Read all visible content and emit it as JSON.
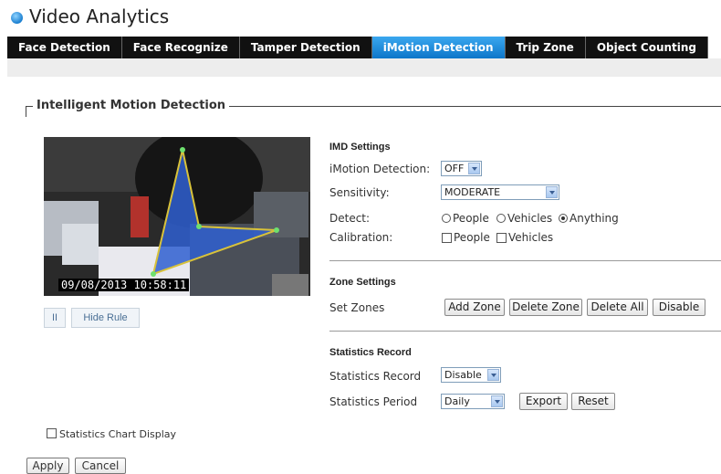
{
  "app": {
    "title": "Video Analytics",
    "logo_icon": "blue-orb-icon"
  },
  "tabs": [
    {
      "label": "Face Detection",
      "active": false
    },
    {
      "label": "Face Recognize",
      "active": false
    },
    {
      "label": "Tamper Detection",
      "active": false
    },
    {
      "label": "iMotion Detection",
      "active": true
    },
    {
      "label": "Trip Zone",
      "active": false
    },
    {
      "label": "Object Counting",
      "active": false
    }
  ],
  "section_title": "Intelligent Motion Detection",
  "video": {
    "timestamp": "09/08/2013   10:58:11",
    "pause_label": "II",
    "hide_rule_label": "Hide Rule"
  },
  "imd": {
    "heading": "IMD Settings",
    "imotion_label": "iMotion Detection:",
    "imotion_value": "OFF",
    "sensitivity_label": "Sensitivity:",
    "sensitivity_value": "MODERATE",
    "detect_label": "Detect:",
    "detect_options": [
      "People",
      "Vehicles",
      "Anything"
    ],
    "detect_selected": "Anything",
    "calibration_label": "Calibration:",
    "calibration_options": [
      "People",
      "Vehicles"
    ]
  },
  "zone": {
    "heading": "Zone Settings",
    "set_zones_label": "Set Zones",
    "buttons": [
      "Add Zone",
      "Delete Zone",
      "Delete All",
      "Disable"
    ]
  },
  "stats": {
    "heading": "Statistics Record",
    "record_label": "Statistics Record",
    "record_value": "Disable",
    "period_label": "Statistics Period",
    "period_value": "Daily",
    "export_label": "Export",
    "reset_label": "Reset"
  },
  "chart_display_label": "Statistics Chart Display",
  "footer": {
    "apply_label": "Apply",
    "cancel_label": "Cancel"
  },
  "colors": {
    "accent": "#0d76c9",
    "tab_dark": "#111111",
    "zone_fill": "#2f5fd0",
    "zone_line": "#d8c23a"
  }
}
